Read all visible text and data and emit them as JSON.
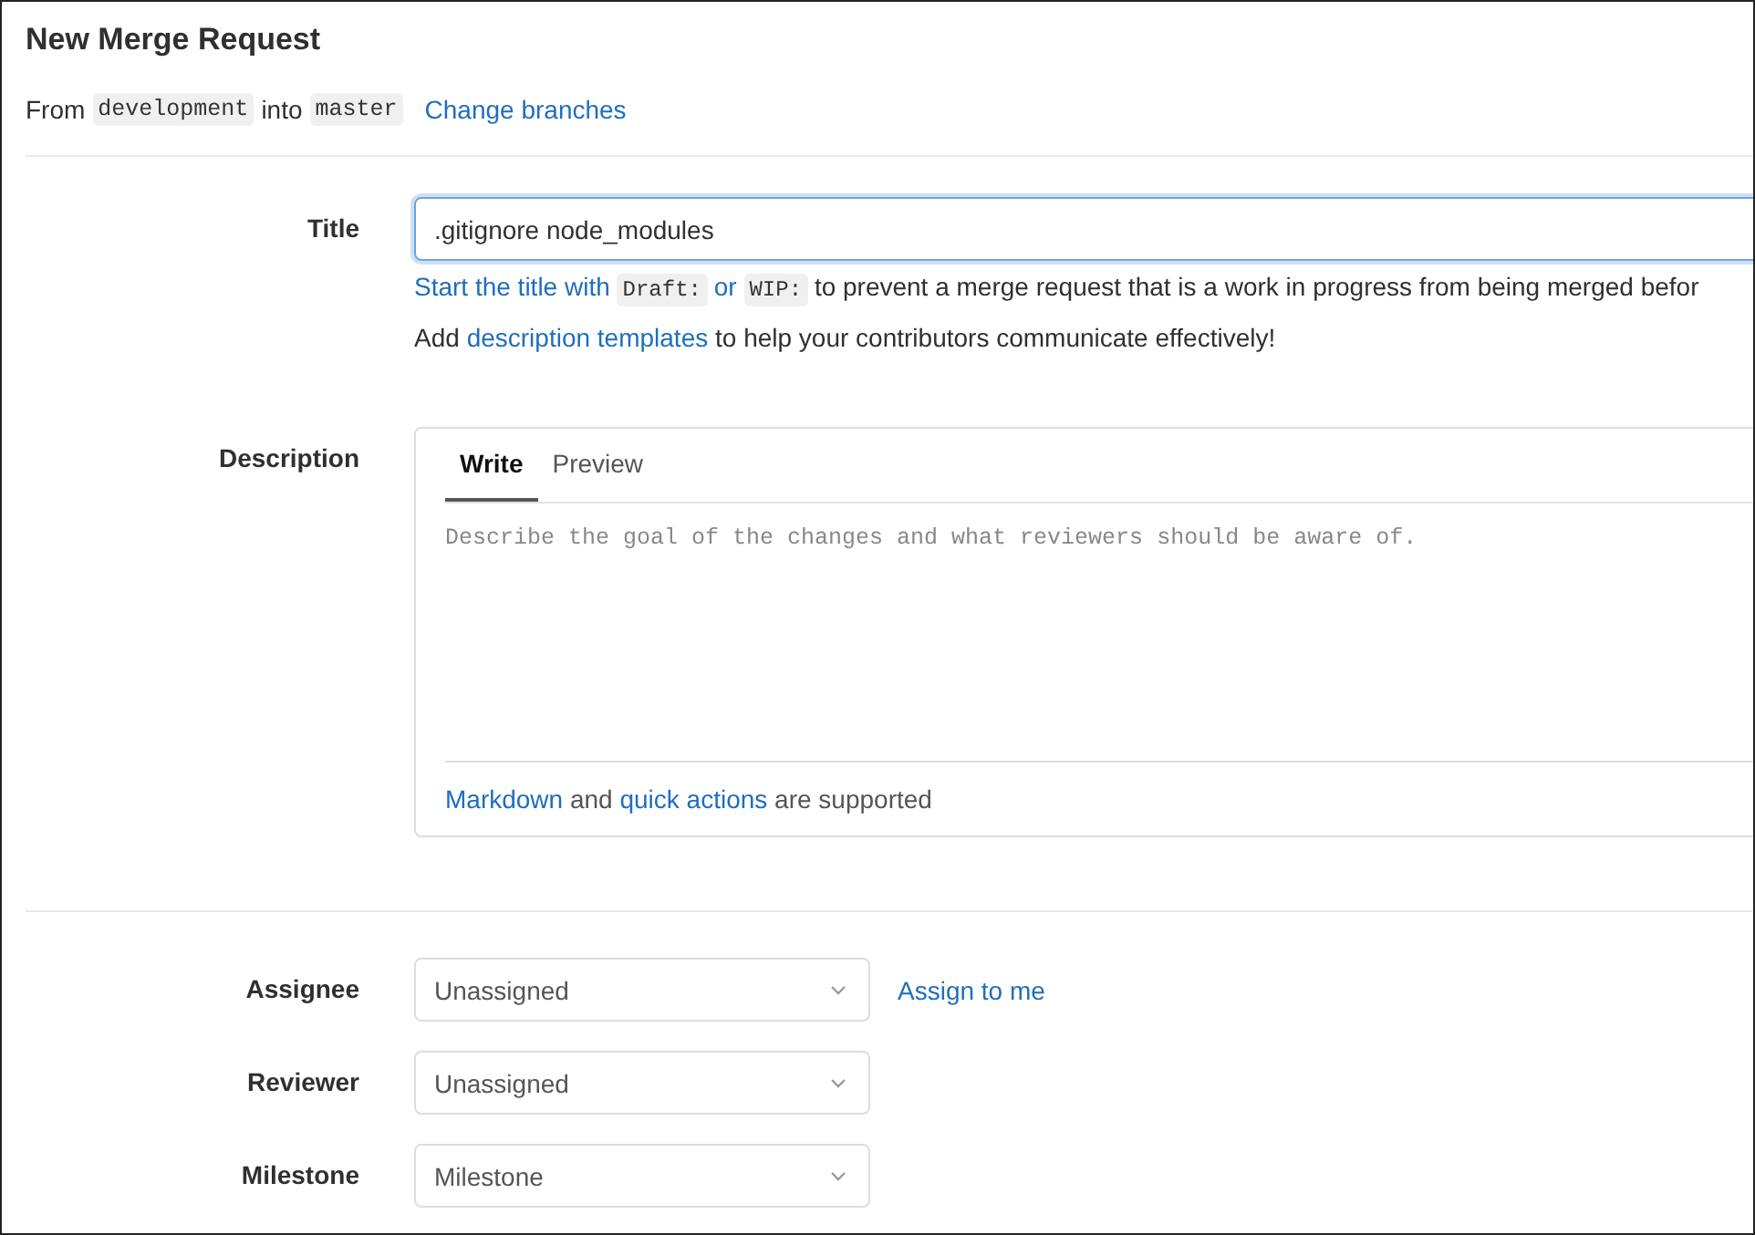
{
  "page_title": "New Merge Request",
  "branches": {
    "prefix": "From",
    "source": "development",
    "joiner": "into",
    "target": "master",
    "link": "Change branches"
  },
  "title_field": {
    "label": "Title",
    "value": ".gitignore node_modules"
  },
  "draft_hint": {
    "link_parts": [
      {
        "kind": "text",
        "text": "Start the title with"
      },
      {
        "kind": "code",
        "text": "Draft:"
      },
      {
        "kind": "text",
        "text": "or"
      },
      {
        "kind": "code",
        "text": "WIP:"
      }
    ],
    "rest": "to prevent a merge request that is a work in progress from being merged befor"
  },
  "template_hint": {
    "prefix": "Add",
    "link": "description templates",
    "suffix": "to help your contributors communicate effectively!"
  },
  "description": {
    "label": "Description",
    "tabs": [
      {
        "label": "Write",
        "selected": true
      },
      {
        "label": "Preview",
        "selected": false
      }
    ],
    "placeholder": "Describe the goal of the changes and what reviewers should be aware of.",
    "footer": {
      "link_1": "Markdown",
      "middle": "and",
      "link_2": "quick actions",
      "suffix": "are supported"
    }
  },
  "selects": [
    {
      "label": "Assignee",
      "value": "Unassigned",
      "action": "Assign to me"
    },
    {
      "label": "Reviewer",
      "value": "Unassigned"
    },
    {
      "label": "Milestone",
      "value": "Milestone"
    }
  ]
}
